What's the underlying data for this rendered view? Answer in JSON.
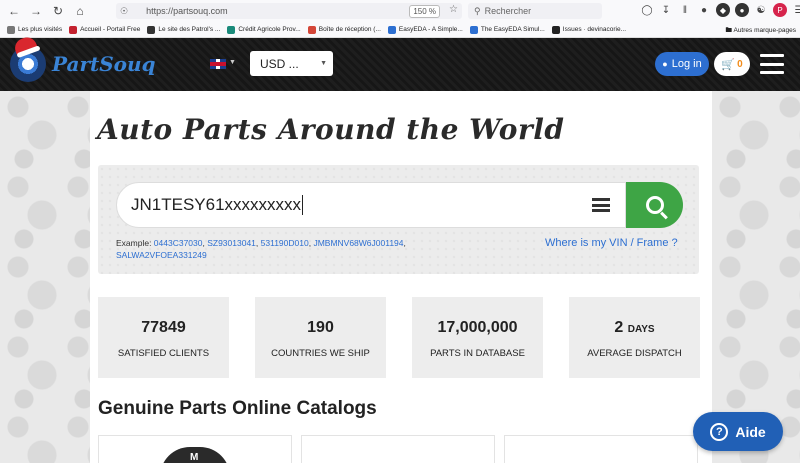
{
  "browser": {
    "url": "https://partsouq.com",
    "zoom": "150 %",
    "search_placeholder": "Rechercher"
  },
  "bookmarks": [
    {
      "label": "Les plus visités",
      "color": "#777777"
    },
    {
      "label": "Accueil - Portail Free",
      "color": "#c4222f"
    },
    {
      "label": "Le site des Patrol's ...",
      "color": "#333333"
    },
    {
      "label": "Crédit Agricole Prov...",
      "color": "#1a8a7a"
    },
    {
      "label": "Boîte de réception (...",
      "color": "#d44638"
    },
    {
      "label": "EasyEDA - A Simple...",
      "color": "#2d6fd1"
    },
    {
      "label": "The EasyEDA Simul...",
      "color": "#2d6fd1"
    },
    {
      "label": "Issues · devinacorie...",
      "color": "#222222"
    }
  ],
  "bookmarks_other": "Autres marque-pages",
  "header": {
    "logo_text": "PartSouq",
    "currency": "USD ...",
    "login_label": "Log in",
    "cart_count": "0"
  },
  "headline": "Auto Parts Around the World",
  "search": {
    "value": "JN1TESY61xxxxxxxxx",
    "examples_prefix": "Example: ",
    "examples": [
      "0443C37030",
      "SZ93013041",
      "531190D010",
      "JMBMNV68W6J001194",
      "SALWA2VFOEA331249"
    ],
    "vin_help": "Where is my VIN / Frame ?"
  },
  "stats": [
    {
      "value": "77849",
      "suffix": "",
      "label": "SATISFIED CLIENTS"
    },
    {
      "value": "190",
      "suffix": "",
      "label": "COUNTRIES WE SHIP"
    },
    {
      "value": "17,000,000",
      "suffix": "",
      "label": "PARTS IN DATABASE"
    },
    {
      "value": "2",
      "suffix": "DAYS",
      "label": "AVERAGE DISPATCH"
    }
  ],
  "catalogs_title": "Genuine Parts Online Catalogs",
  "catalog_badge": "M",
  "help_label": "Aide"
}
